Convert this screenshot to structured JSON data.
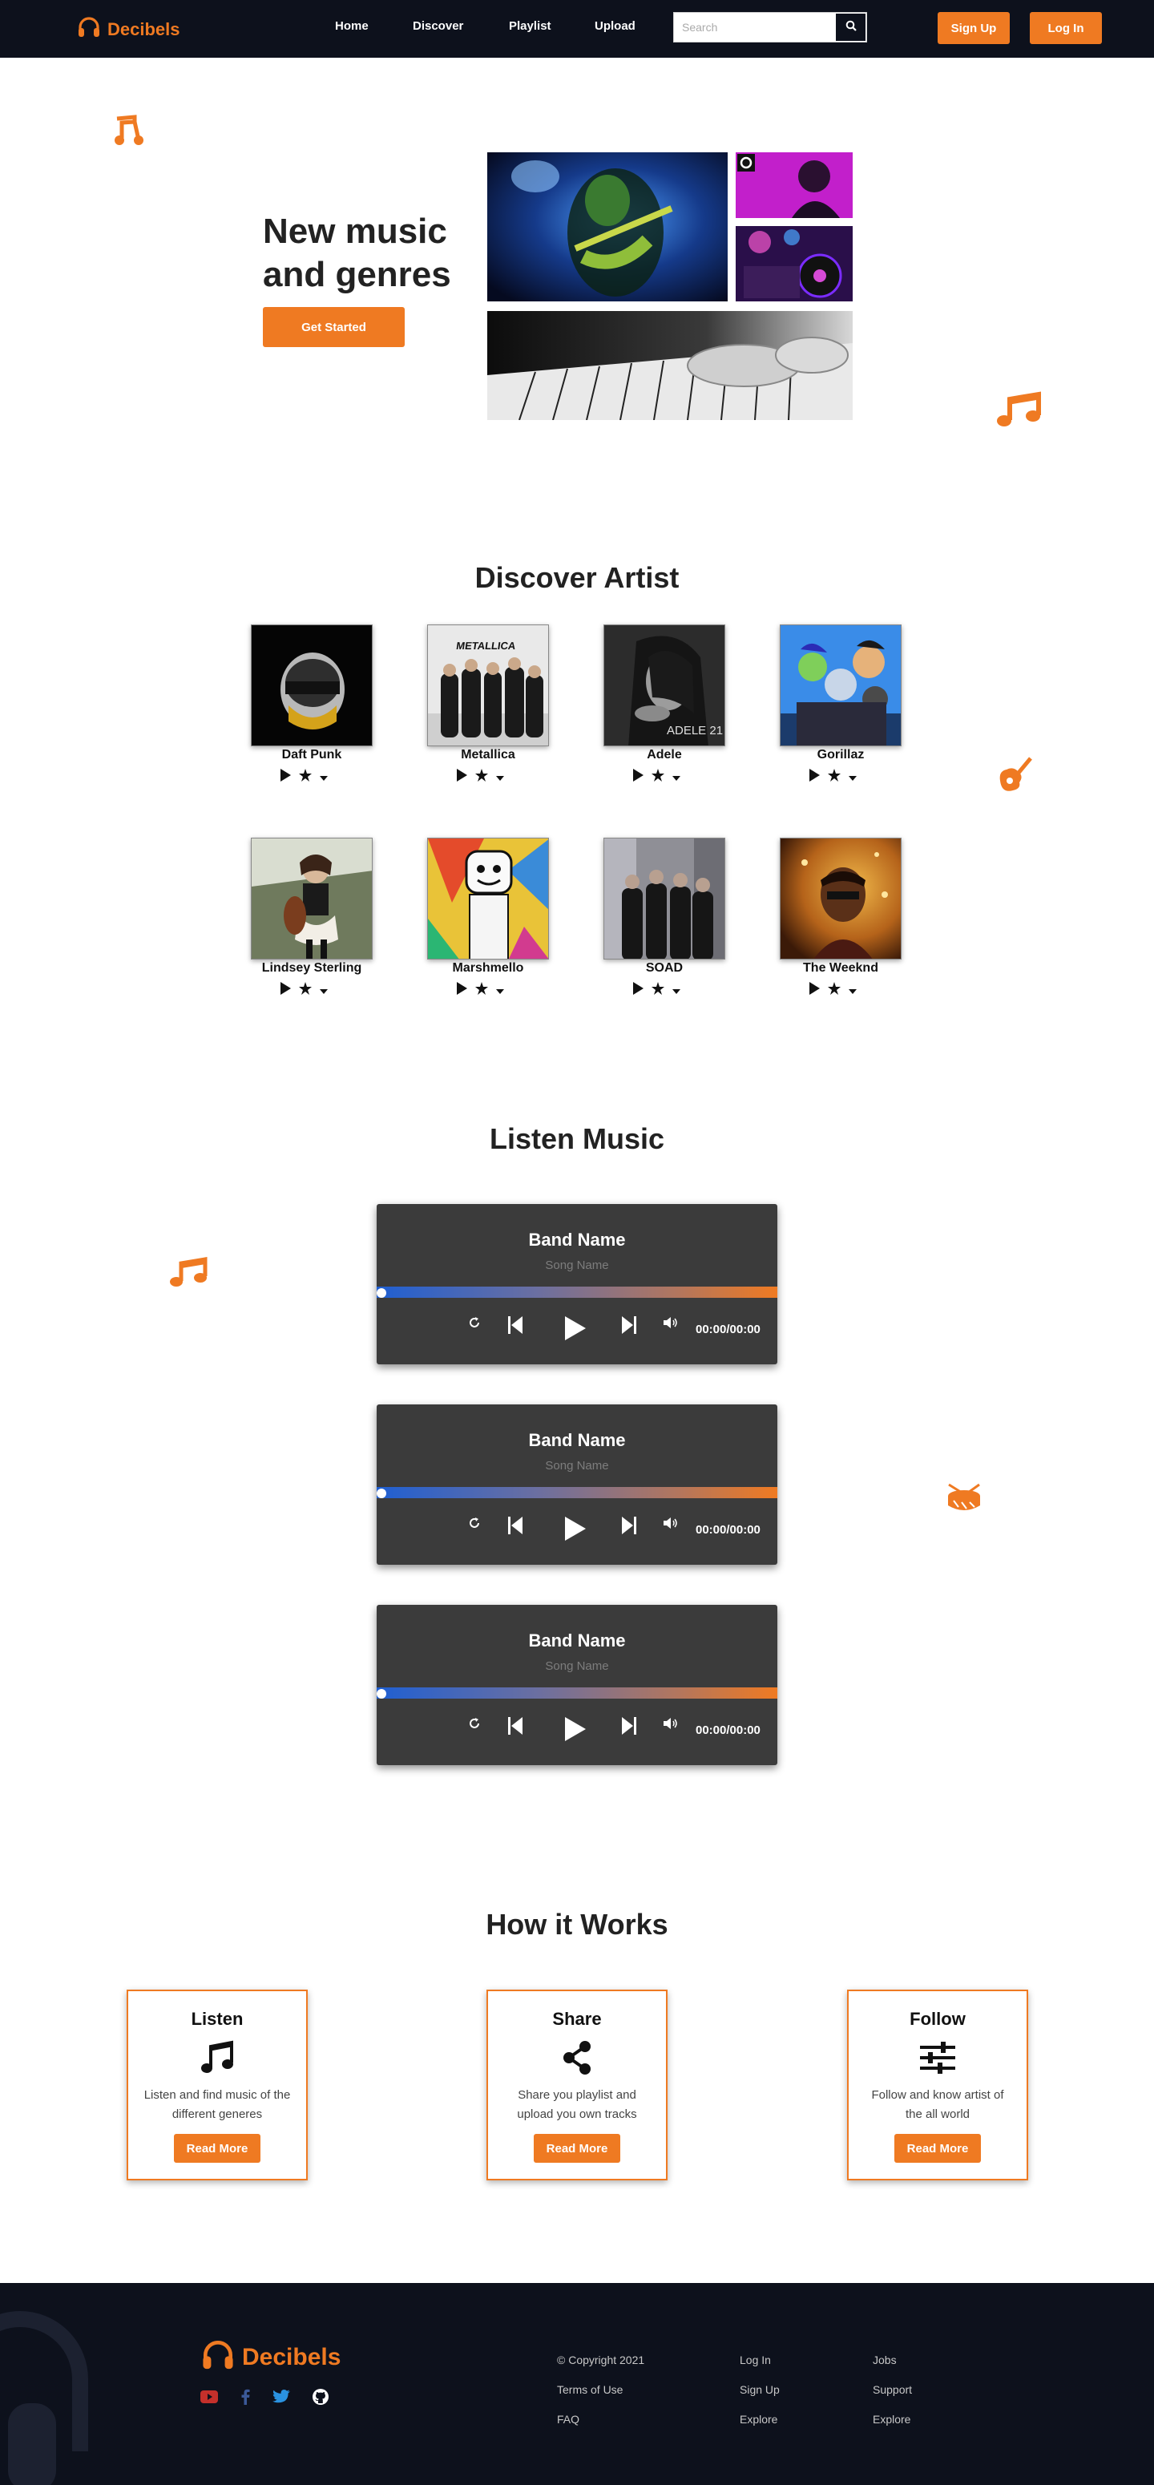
{
  "nav": {
    "brand": "Decibels",
    "links": [
      "Home",
      "Discover",
      "Playlist",
      "Upload"
    ],
    "search_placeholder": "Search",
    "signup": "Sign Up",
    "login": "Log In"
  },
  "hero": {
    "title": "New music and genres",
    "cta": "Get Started"
  },
  "discover": {
    "title": "Discover Artist",
    "artists": [
      {
        "name": "Daft Punk"
      },
      {
        "name": "Metallica"
      },
      {
        "name": "Adele"
      },
      {
        "name": "Gorillaz"
      },
      {
        "name": "Lindsey Sterling"
      },
      {
        "name": "Marshmello"
      },
      {
        "name": "SOAD"
      },
      {
        "name": "The Weeknd"
      }
    ],
    "album_text": {
      "metallica": "METALLICA",
      "adele": "ADELE 21"
    }
  },
  "listen": {
    "title": "Listen Music",
    "players": [
      {
        "band": "Band Name",
        "song": "Song Name",
        "time": "00:00/00:00",
        "progress": 0
      },
      {
        "band": "Band Name",
        "song": "Song Name",
        "time": "00:00/00:00",
        "progress": 0
      },
      {
        "band": "Band Name",
        "song": "Song Name",
        "time": "00:00/00:00",
        "progress": 0
      }
    ]
  },
  "how": {
    "title": "How it Works",
    "cards": [
      {
        "title": "Listen",
        "text": "Listen and find music of the different generes",
        "button": "Read More",
        "icon": "music-note-icon"
      },
      {
        "title": "Share",
        "text": "Share you playlist and upload you own tracks",
        "button": "Read More",
        "icon": "share-icon"
      },
      {
        "title": "Follow",
        "text": "Follow and know artist of the all world",
        "button": "Read More",
        "icon": "sliders-icon"
      }
    ]
  },
  "footer": {
    "brand": "Decibels",
    "col1": [
      "© Copyright 2021",
      "Terms of Use",
      "FAQ"
    ],
    "col2": [
      "Log In",
      "Sign Up",
      "Explore"
    ],
    "col3": [
      "Jobs",
      "Support",
      "Explore"
    ],
    "socials": [
      "youtube-icon",
      "facebook-icon",
      "twitter-icon",
      "github-icon"
    ]
  },
  "colors": {
    "accent": "#ef7a22",
    "dark": "#0d111c",
    "player": "#3b3b3b"
  }
}
